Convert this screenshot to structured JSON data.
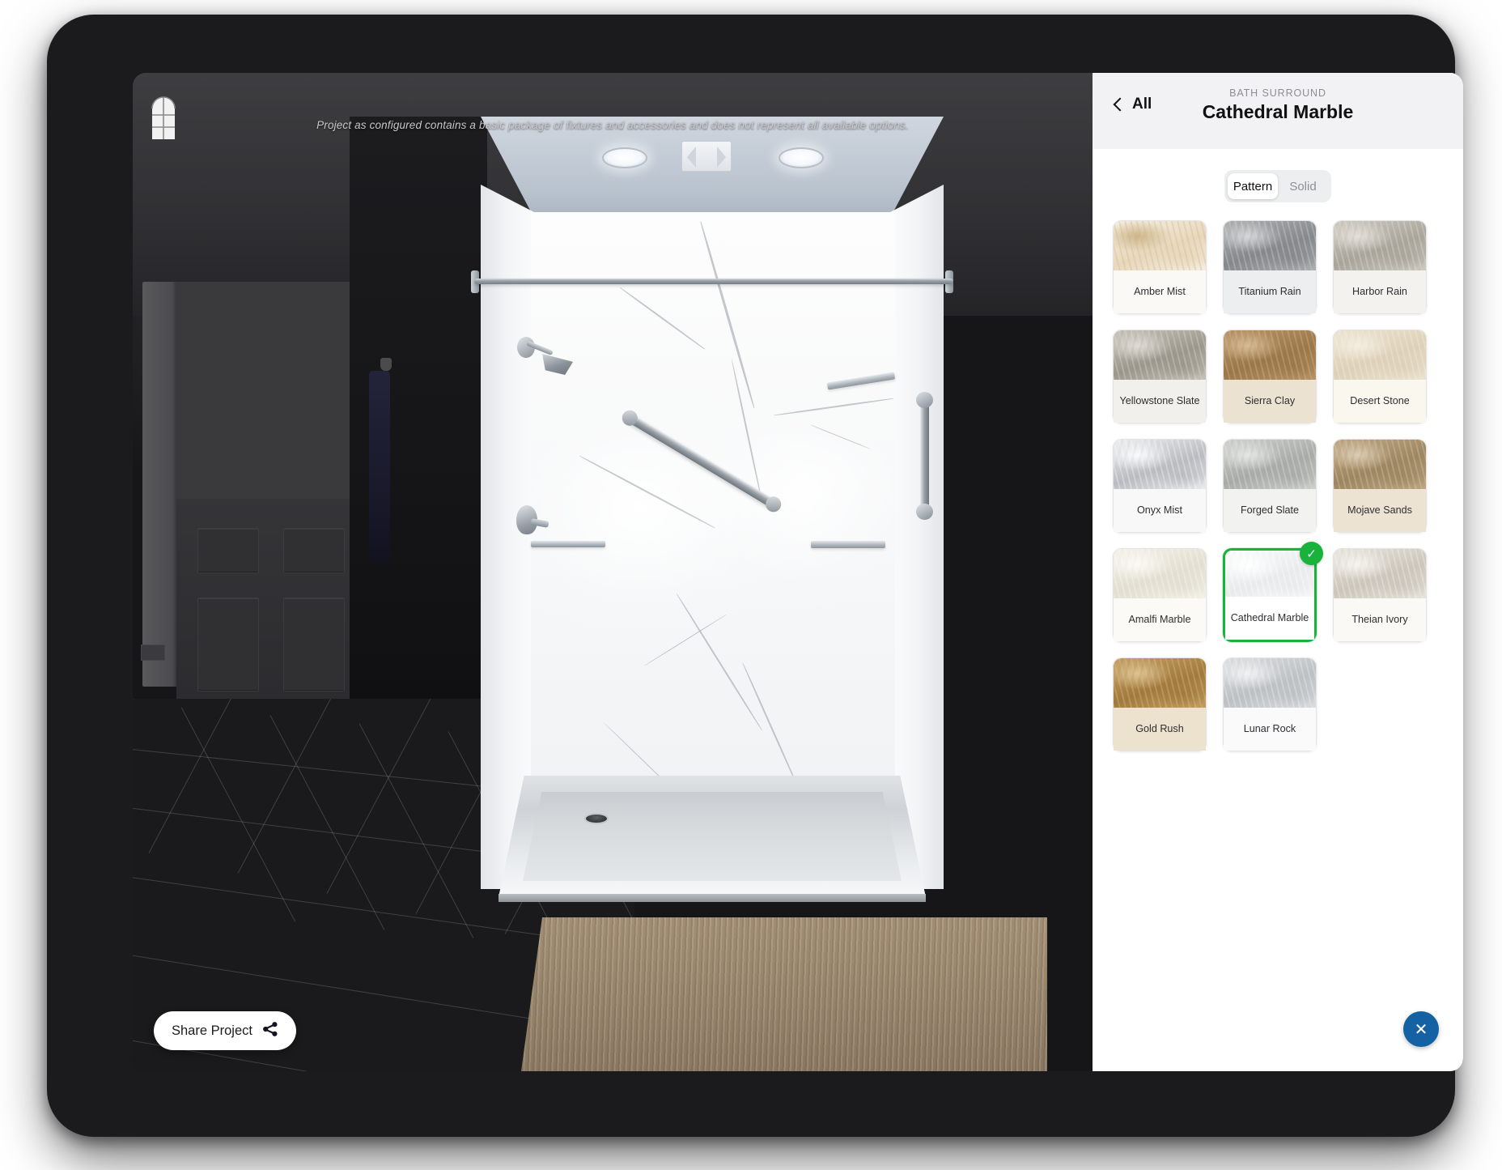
{
  "viewport": {
    "disclaimer": "Project as configured contains a basic package of fixtures and accessories and does not represent all available options.",
    "window_icon": "window-icon",
    "share_button": {
      "label": "Share Project",
      "icon": "share-icon"
    }
  },
  "panel": {
    "back": {
      "label": "All",
      "icon": "chevron-left-icon"
    },
    "category": "BATH SURROUND",
    "title": "Cathedral Marble",
    "toggle": {
      "options": [
        "Pattern",
        "Solid"
      ],
      "selected": "Pattern"
    },
    "close_button": {
      "icon": "close-icon",
      "glyph": "✕"
    },
    "selected_swatch": "Cathedral Marble",
    "selected_check_glyph": "✓",
    "accent_color": "#19b33c",
    "close_color": "#1462a4",
    "swatches": [
      {
        "name": "Amber Mist",
        "c1": "#f6efe4",
        "c2": "#e8d8bc",
        "c3": "#cbb488",
        "cap": "#fbf9f5"
      },
      {
        "name": "Titanium Rain",
        "c1": "#aeb0b1",
        "c2": "#85888b",
        "c3": "#d6d8d9",
        "cap": "#eceeef"
      },
      {
        "name": "Harbor Rain",
        "c1": "#cfcbc2",
        "c2": "#a9a49a",
        "c3": "#e4e1da",
        "cap": "#f3f2ee"
      },
      {
        "name": "Yellowstone Slate",
        "c1": "#c9c4b9",
        "c2": "#9b968c",
        "c3": "#e0ddd6",
        "cap": "#f1f0ed"
      },
      {
        "name": "Sierra Clay",
        "c1": "#b99568",
        "c2": "#9a7749",
        "c3": "#d8bc96",
        "cap": "#ece2d1"
      },
      {
        "name": "Desert Stone",
        "c1": "#ece3d1",
        "c2": "#ddd0b7",
        "c3": "#f4efe3",
        "cap": "#faf7ef"
      },
      {
        "name": "Onyx Mist",
        "c1": "#ededef",
        "c2": "#b9bbc0",
        "c3": "#fbfbfc",
        "cap": "#f8f8f9"
      },
      {
        "name": "Forged Slate",
        "c1": "#cfd1cf",
        "c2": "#a8aaa8",
        "c3": "#e6e7e5",
        "cap": "#f2f2f1"
      },
      {
        "name": "Mojave Sands",
        "c1": "#c0a884",
        "c2": "#9d8561",
        "c3": "#dccdb4",
        "cap": "#ece3d2"
      },
      {
        "name": "Amalfi Marble",
        "c1": "#f4f2e9",
        "c2": "#e2ded0",
        "c3": "#fbfaf6",
        "cap": "#fbfaf6"
      },
      {
        "name": "Cathedral Marble",
        "c1": "#fbfbfc",
        "c2": "#e8eaec",
        "c3": "#ffffff",
        "cap": "#ffffff"
      },
      {
        "name": "Theian Ivory",
        "c1": "#e9e5dd",
        "c2": "#cbc5ba",
        "c3": "#f7f5f1",
        "cap": "#faf9f6"
      },
      {
        "name": "Gold Rush",
        "c1": "#c5a064",
        "c2": "#a1793d",
        "c3": "#ddc493",
        "cap": "#ece2cd"
      },
      {
        "name": "Lunar Rock",
        "c1": "#dcdee0",
        "c2": "#bcc0c3",
        "c3": "#f2f3f4",
        "cap": "#fafafb"
      }
    ]
  }
}
